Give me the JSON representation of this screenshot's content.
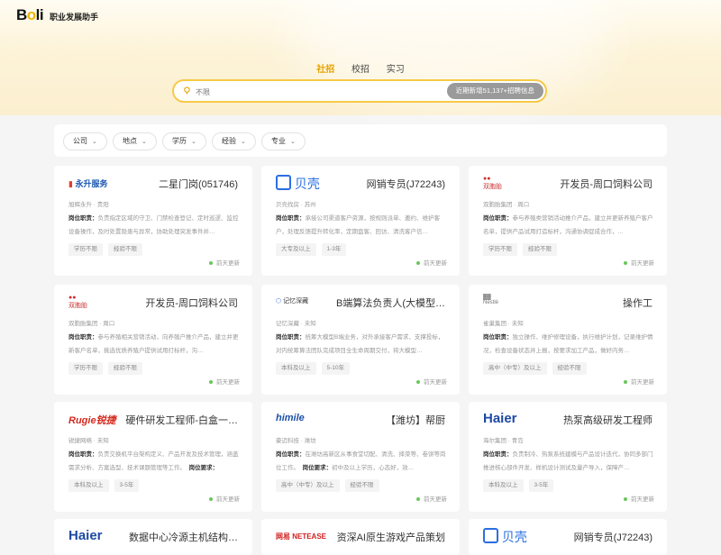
{
  "brand": {
    "logo": "Boli",
    "subtitle": "职业发展助手"
  },
  "tabs": [
    {
      "label": "社招",
      "active": true
    },
    {
      "label": "校招",
      "active": false
    },
    {
      "label": "实习",
      "active": false
    }
  ],
  "search": {
    "placeholder": "不限",
    "button": "近期新增51,137+招聘信息"
  },
  "filters": [
    "公司",
    "地点",
    "学历",
    "经验",
    "专业"
  ],
  "cards": [
    {
      "company_logo": "永升服务",
      "title": "二星门岗(051746)",
      "meta": "旭辉永升 · 贵阳",
      "desc_label": "岗位职责：",
      "desc": "负责指定区域的守卫、门禁检查登记、定时巡逻、监控设备操作，及时处置隐患与异常，协助处理突发事件并…",
      "tags": [
        "学历不限",
        "经验不限"
      ],
      "updated": "前天更新"
    },
    {
      "company_logo": "贝壳",
      "title": "网销专员(J72243)",
      "meta": "贝壳找房 · 苏州",
      "desc_label": "岗位职责：",
      "desc": "承接公司渠道客户资源，按规则派单、邀约、维护客户，处理反馈提升转化率，定期盘客、回访、清洗客户信…",
      "tags": [
        "大专及以上",
        "1-3年"
      ],
      "updated": "前天更新"
    },
    {
      "company_logo": "双胞胎",
      "title": "开发员-周口饲料公司",
      "meta": "双胞胎集团 · 周口",
      "desc_label": "岗位职责：",
      "desc": "参与养殖类营销活动推介产品，建立并更新养殖户客户名单，提供产品试用打造标杆，沟通协调促成合作，…",
      "tags": [
        "学历不限",
        "经验不限"
      ],
      "updated": "前天更新"
    },
    {
      "company_logo": "双胞胎",
      "title": "开发员-周口饲料公司",
      "meta": "双胞胎集团 · 周口",
      "desc_label": "岗位职责：",
      "desc": "参与养殖相关营销活动，向养殖户推介产品，建立并更新客户名单，挑选优质养殖户提供试用打标杆，沟…",
      "tags": [
        "学历不限",
        "经验不限"
      ],
      "updated": "前天更新"
    },
    {
      "company_logo": "记忆深藏",
      "title": "B端算法负责人(大模型…",
      "meta": "记忆深藏 · 未知",
      "desc_label": "岗位职责：",
      "desc": "统筹大模型B端业务，对外承接客户需求、支撑投标，对内统筹算法团队完成项目全生命周期交付，将大模型…",
      "tags": [
        "本科及以上",
        "5-10年"
      ],
      "updated": "前天更新"
    },
    {
      "company_logo": "Nestlé",
      "title": "操作工",
      "meta": "雀巢集团 · 未知",
      "desc_label": "岗位职责：",
      "desc": "独立操作、维护修理设备，执行维护计划，记录维护情况，检查设备状态并上报，按要求加工产品，做好内务…",
      "tags": [
        "高中（中专）及以上",
        "经验不限"
      ],
      "updated": "前天更新"
    },
    {
      "company_logo": "Rugie锐捷",
      "title": "硬件研发工程师-白盒一…",
      "meta": "锐捷网络 · 未知",
      "desc_label": "岗位职责：",
      "desc": "负责交换机平台架构定义、产品开发及技术管理，涵盖需求分析、方案选型、技术课题管理等工作。",
      "desc_label2": "岗位要求：",
      "tags": [
        "本科及以上",
        "3-5年"
      ],
      "updated": "前天更新"
    },
    {
      "company_logo": "himile",
      "title": "【潍坊】帮厨",
      "meta": "豪迈科技 · 潍坊",
      "desc_label": "岗位职责：",
      "desc": "在潍坊高新区从事食堂切配、清洗、择菜等、卷饼等岗位工作。",
      "desc_label2": "岗位要求：",
      "desc2": "初中及以上学历，心态好，效…",
      "tags": [
        "高中（中专）及以上",
        "经验不限"
      ],
      "updated": "前天更新"
    },
    {
      "company_logo": "Haier",
      "title": "热泵高级研发工程师",
      "meta": "海尔集团 · 青岛",
      "desc_label": "岗位职责：",
      "desc": "负责制冷、热泵系统建模与产品设计迭代，协同多部门推进核心部件开发、样机设计测试及量产导入，保障产…",
      "tags": [
        "本科及以上",
        "3-5年"
      ],
      "updated": "前天更新"
    },
    {
      "company_logo": "Haier",
      "title": "数据中心冷源主机结构…"
    },
    {
      "company_logo": "网易 NETEASE",
      "title": "资深AI原生游戏产品策划"
    },
    {
      "company_logo": "贝壳",
      "title": "网销专员(J72243)"
    }
  ],
  "colors": {
    "accent": "#e6a400",
    "search_border": "#f7c948",
    "update_dot": "#6ac65b"
  }
}
